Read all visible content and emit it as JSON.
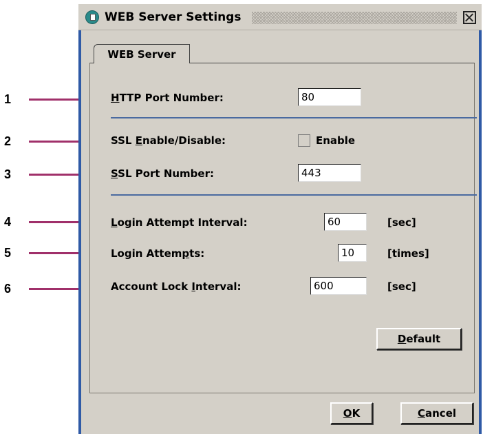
{
  "callouts": [
    "1",
    "2",
    "3",
    "4",
    "5",
    "6"
  ],
  "window": {
    "title": "WEB Server Settings",
    "icon": "server-settings-icon",
    "close_icon": "close-icon"
  },
  "tabs": [
    {
      "label": "WEB Server",
      "selected": true
    }
  ],
  "settings": {
    "http_port": {
      "label_pre": "",
      "label_key": "H",
      "label_post": "TTP Port Number:",
      "value": "80"
    },
    "ssl_enable": {
      "label_pre": "SSL ",
      "label_key": "E",
      "label_post": "nable/Disable:",
      "checkbox_label": "Enable",
      "checked": false
    },
    "ssl_port": {
      "label_pre": "",
      "label_key": "S",
      "label_post": "SL Port Number:",
      "value": "443"
    },
    "login_interval": {
      "label_pre": "",
      "label_key": "L",
      "label_post": "ogin Attempt Interval:",
      "value": "60",
      "unit": "[sec]"
    },
    "login_attempts": {
      "label_pre": "Login Attem",
      "label_key": "p",
      "label_post": "ts:",
      "value": "10",
      "unit": "[times]"
    },
    "lock_interval": {
      "label_pre": "Account Lock ",
      "label_key": "I",
      "label_post": "nterval:",
      "value": "600",
      "unit": "[sec]"
    }
  },
  "buttons": {
    "default": {
      "key": "D",
      "rest": "efault"
    },
    "ok": {
      "key": "O",
      "rest": "K"
    },
    "cancel": {
      "key": "C",
      "rest": "ancel"
    }
  },
  "colors": {
    "callout_line": "#a0306a",
    "separator": "#4a6aa0",
    "frame": "#2f5aa6"
  }
}
